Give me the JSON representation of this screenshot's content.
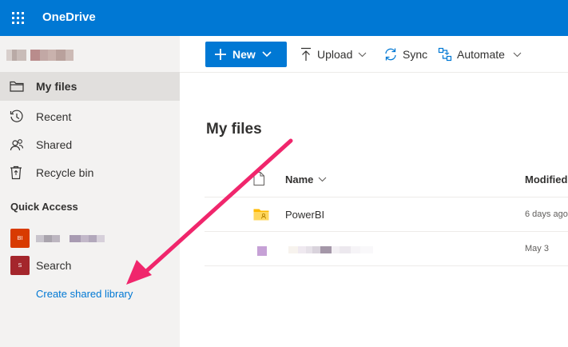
{
  "app": {
    "title": "OneDrive"
  },
  "sidebar": {
    "items": [
      {
        "label": "My files",
        "icon": "folder-icon",
        "active": true
      },
      {
        "label": "Recent",
        "icon": "history-icon"
      },
      {
        "label": "Shared",
        "icon": "people-icon"
      },
      {
        "label": "Recycle bin",
        "icon": "recycle-bin-icon"
      }
    ],
    "quick_access_heading": "Quick Access",
    "quick_access": [
      {
        "label": "",
        "badge": "BI",
        "color": "#d83b01"
      },
      {
        "label": "Search",
        "badge": "S",
        "color": "#a4262c"
      }
    ],
    "create_link": "Create shared library"
  },
  "toolbar": {
    "new_label": "New",
    "upload_label": "Upload",
    "sync_label": "Sync",
    "automate_label": "Automate"
  },
  "main": {
    "title": "My files",
    "columns": {
      "name": "Name",
      "modified": "Modified"
    },
    "rows": [
      {
        "name": "PowerBI",
        "modified": "6 days ago",
        "type": "shared-folder"
      },
      {
        "name": "",
        "modified": "May 3",
        "type": "file"
      }
    ]
  },
  "colors": {
    "accent": "#0078d4",
    "annotation_arrow": "#f0266c"
  }
}
